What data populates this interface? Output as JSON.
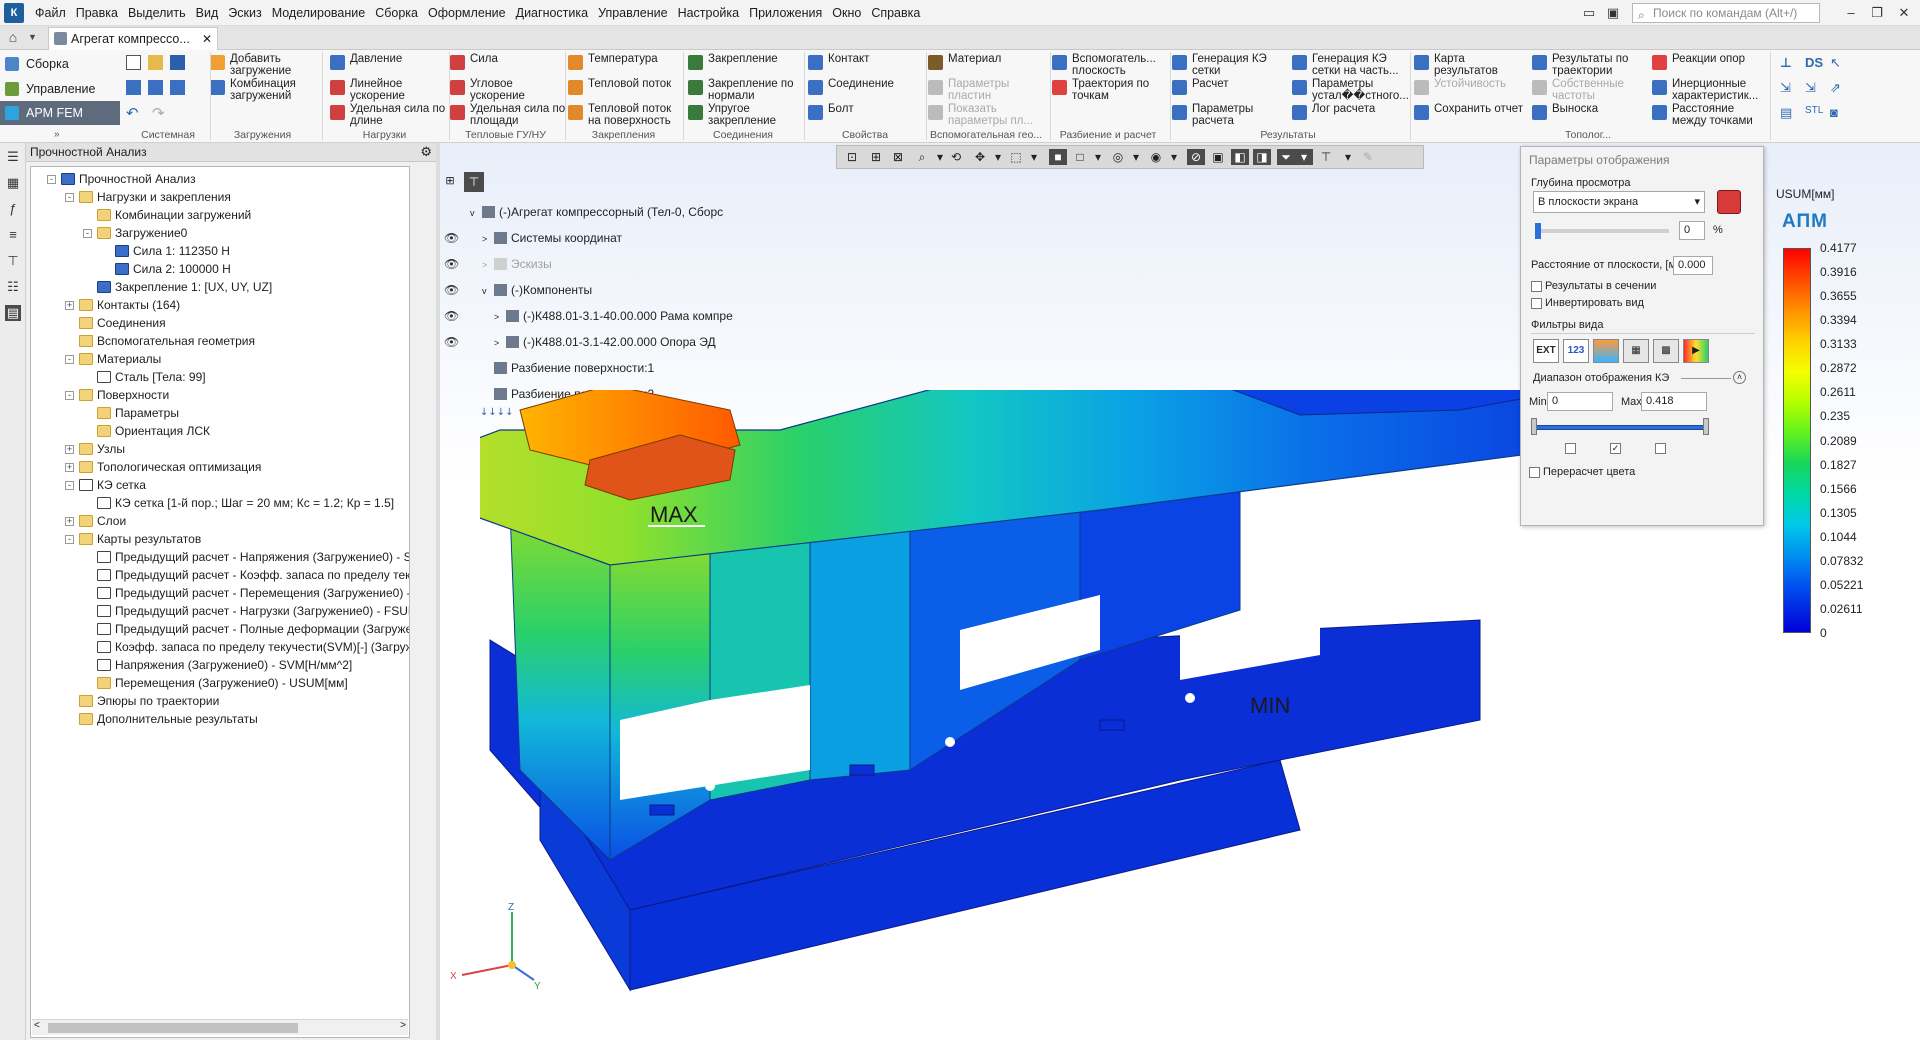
{
  "menu": {
    "logo": "К",
    "items": [
      "Файл",
      "Правка",
      "Выделить",
      "Вид",
      "Эскиз",
      "Моделирование",
      "Сборка",
      "Оформление",
      "Диагностика",
      "Управление",
      "Настройка",
      "Приложения",
      "Окно",
      "Справка"
    ]
  },
  "search": {
    "placeholder": "Поиск по командам (Alt+/)"
  },
  "document_tab": {
    "title": "Агрегат компрессо..."
  },
  "modes": [
    "Сборка",
    "Управление",
    "APM FEM"
  ],
  "ribbon": {
    "buttons": [
      {
        "label": "Добавить загружение",
        "enabled": true
      },
      {
        "label": "Комбинация загружений",
        "enabled": true
      },
      {
        "label": "Давление",
        "enabled": true
      },
      {
        "label": "Линейное ускорение",
        "enabled": true
      },
      {
        "label": "Удельная сила по длине",
        "enabled": true
      },
      {
        "label": "Сила",
        "enabled": true
      },
      {
        "label": "Угловое ускорение",
        "enabled": true
      },
      {
        "label": "Удельная сила по площади",
        "enabled": true
      },
      {
        "label": "Температура",
        "enabled": true
      },
      {
        "label": "Тепловой поток",
        "enabled": true
      },
      {
        "label": "Тепловой поток на поверхность",
        "enabled": true
      },
      {
        "label": "Закрепление",
        "enabled": true
      },
      {
        "label": "Закрепление по нормали",
        "enabled": true
      },
      {
        "label": "Упругое закрепление",
        "enabled": true
      },
      {
        "label": "Контакт",
        "enabled": true
      },
      {
        "label": "Соединение",
        "enabled": true
      },
      {
        "label": "Болт",
        "enabled": true
      },
      {
        "label": "Материал",
        "enabled": true
      },
      {
        "label": "Параметры пластин",
        "enabled": false
      },
      {
        "label": "Показать параметры пл...",
        "enabled": false
      },
      {
        "label": "Вспомогатель... плоскость",
        "enabled": true
      },
      {
        "label": "Траектория по точкам",
        "enabled": true
      },
      {
        "label": "Генерация КЭ сетки",
        "enabled": true
      },
      {
        "label": "Расчет",
        "enabled": true
      },
      {
        "label": "Параметры расчета",
        "enabled": true
      },
      {
        "label": "Генерация КЭ сетки на часть...",
        "enabled": true
      },
      {
        "label": "Параметры устал��стного...",
        "enabled": true
      },
      {
        "label": "Лог расчета",
        "enabled": true
      },
      {
        "label": "Карта результатов",
        "enabled": true
      },
      {
        "label": "Устойчивость",
        "enabled": false
      },
      {
        "label": "Сохранить отчет",
        "enabled": true
      },
      {
        "label": "Результаты по траектории",
        "enabled": true
      },
      {
        "label": "Собственные частоты",
        "enabled": false
      },
      {
        "label": "Выноска",
        "enabled": true
      },
      {
        "label": "Реакции опор",
        "enabled": true
      },
      {
        "label": "Инерционные характеристик...",
        "enabled": true
      },
      {
        "label": "Расстояние между точками",
        "enabled": true
      }
    ],
    "groups": [
      "Системная",
      "Загружения",
      "Нагрузки",
      "Тепловые ГУ/НУ",
      "Закрепления",
      "Соединения",
      "Свойства",
      "Вспомогательная гео...",
      "Разбиение и расчет",
      "Результаты",
      "Тополог..."
    ]
  },
  "tree": {
    "title": "Прочностной Анализ",
    "items": [
      {
        "text": "Прочностной Анализ",
        "level": 0,
        "icon": "analysis-icon",
        "toggle": "-"
      },
      {
        "text": "Нагрузки и закрепления",
        "level": 1,
        "icon": "folder-icon",
        "toggle": "-"
      },
      {
        "text": "Комбинации загружений",
        "level": 2,
        "icon": "folder-icon",
        "toggle": ""
      },
      {
        "text": "Загружение0",
        "level": 2,
        "icon": "folder-icon",
        "toggle": "-"
      },
      {
        "text": "Сила 1: 112350 Н",
        "level": 3,
        "icon": "force-icon",
        "toggle": ""
      },
      {
        "text": "Сила 2: 100000 Н",
        "level": 3,
        "icon": "force-icon",
        "toggle": ""
      },
      {
        "text": "Закрепление 1: [UX, UY, UZ]",
        "level": 2,
        "icon": "fixation-icon",
        "toggle": ""
      },
      {
        "text": "Контакты (164)",
        "level": 1,
        "icon": "folder-icon",
        "toggle": "+"
      },
      {
        "text": "Соединения",
        "level": 1,
        "icon": "folder-icon",
        "toggle": ""
      },
      {
        "text": "Вспомогательная геометрия",
        "level": 1,
        "icon": "folder-icon",
        "toggle": ""
      },
      {
        "text": "Материалы",
        "level": 1,
        "icon": "folder-icon",
        "toggle": "-"
      },
      {
        "text": "Сталь [Тела: 99]",
        "level": 2,
        "icon": "material-icon",
        "toggle": ""
      },
      {
        "text": "Поверхности",
        "level": 1,
        "icon": "folder-icon",
        "toggle": "-"
      },
      {
        "text": "Параметры",
        "level": 2,
        "icon": "folder-icon",
        "toggle": ""
      },
      {
        "text": "Ориентация ЛСК",
        "level": 2,
        "icon": "folder-icon",
        "toggle": ""
      },
      {
        "text": "Узлы",
        "level": 1,
        "icon": "folder-icon",
        "toggle": "+"
      },
      {
        "text": "Топологическая оптимизация",
        "level": 1,
        "icon": "topology-icon",
        "toggle": "+"
      },
      {
        "text": "КЭ сетка",
        "level": 1,
        "icon": "mesh-icon",
        "toggle": "-"
      },
      {
        "text": "КЭ сетка [1-й пор.; Шаг = 20 мм; Кс = 1.2; Кр = 1.5]",
        "level": 2,
        "icon": "mesh-icon",
        "toggle": ""
      },
      {
        "text": "Слои",
        "level": 1,
        "icon": "folder-icon",
        "toggle": "+"
      },
      {
        "text": "Карты результатов",
        "level": 1,
        "icon": "folder-icon",
        "toggle": "-"
      },
      {
        "text": "Предыдущий расчет - Напряжения (Загружение0) - SV",
        "level": 2,
        "icon": "result-icon",
        "toggle": ""
      },
      {
        "text": "Предыдущий расчет - Коэфф. запаса по пределу теку",
        "level": 2,
        "icon": "result-icon",
        "toggle": ""
      },
      {
        "text": "Предыдущий расчет - Перемещения (Загружение0) -",
        "level": 2,
        "icon": "result-icon",
        "toggle": ""
      },
      {
        "text": "Предыдущий расчет - Нагрузки (Загружение0) - FSUM",
        "level": 2,
        "icon": "result-icon",
        "toggle": ""
      },
      {
        "text": "Предыдущий расчет - Полные деформации (Загружe",
        "level": 2,
        "icon": "result-icon",
        "toggle": ""
      },
      {
        "text": "Коэфф. запаса по пределу текучести(SVM)[-] (Загруже",
        "level": 2,
        "icon": "result-icon",
        "toggle": ""
      },
      {
        "text": "Напряжения (Загружение0) - SVM[Н/мм^2]",
        "level": 2,
        "icon": "result-icon",
        "toggle": ""
      },
      {
        "text": "Перемещения (Загружение0) - USUM[мм]",
        "level": 2,
        "icon": "result-active-icon",
        "toggle": ""
      },
      {
        "text": "Эпюры по траектории",
        "level": 1,
        "icon": "folder-icon",
        "toggle": ""
      },
      {
        "text": "Дополнительные результаты",
        "level": 1,
        "icon": "folder-icon",
        "toggle": ""
      }
    ]
  },
  "overlay_tree": [
    {
      "text": "(-)Агрегат компрессорный (Тел-0, Сборс",
      "level": 0,
      "eye": false,
      "dim": false,
      "toggle": "v"
    },
    {
      "text": "Системы координат",
      "level": 1,
      "eye": true,
      "dim": false,
      "toggle": ">"
    },
    {
      "text": "Эскизы",
      "level": 1,
      "eye": true,
      "dim": true,
      "toggle": ">"
    },
    {
      "text": "(-)Компоненты",
      "level": 1,
      "eye": true,
      "dim": false,
      "toggle": "v"
    },
    {
      "text": "(-)К488.01-3.1-40.00.000  Рама компре",
      "level": 2,
      "eye": true,
      "dim": false,
      "toggle": ">"
    },
    {
      "text": "(-)К488.01-3.1-42.00.000  Опора ЭД",
      "level": 2,
      "eye": true,
      "dim": false,
      "toggle": ">"
    },
    {
      "text": "Разбиение поверхности:1",
      "level": 1,
      "eye": false,
      "dim": false,
      "toggle": ""
    },
    {
      "text": "Разбиение поверхности:2",
      "level": 1,
      "eye": false,
      "dim": false,
      "toggle": ""
    }
  ],
  "display_params": {
    "title": "Параметры отображения",
    "depth_label": "Глубина просмотра",
    "depth_value": "В плоскости экрана",
    "depth_percent": "0",
    "percent_sign": "%",
    "distance_label": "Расстояние от плоскости, [мм]",
    "distance_value": "0.000",
    "section_results_label": "Результаты в сечении",
    "section_results_checked": false,
    "invert_label": "Инвертировать вид",
    "invert_checked": false,
    "filters_label": "Фильтры вида",
    "filters": [
      "EXT",
      "123",
      "contour",
      "mesh",
      "mesh-edges",
      "gradient"
    ],
    "range_label": "Диапазон отображения КЭ",
    "min_label": "Min",
    "min_value": "0",
    "max_label": "Max",
    "max_value": "0.418",
    "range_checks": [
      false,
      true,
      false
    ],
    "recolor_label": "Перерасчет цвета",
    "recolor_checked": false
  },
  "legend": {
    "unit": "USUM[мм]",
    "brand": "АПМ",
    "values": [
      "0.4177",
      "0.3916",
      "0.3655",
      "0.3394",
      "0.3133",
      "0.2872",
      "0.2611",
      "0.235",
      "0.2089",
      "0.1827",
      "0.1566",
      "0.1305",
      "0.1044",
      "0.07832",
      "0.05221",
      "0.02611",
      "0"
    ]
  },
  "model_labels": {
    "max": "MAX",
    "min": "MIN"
  },
  "triad": {
    "x": "X",
    "y": "Y",
    "z": "Z"
  }
}
